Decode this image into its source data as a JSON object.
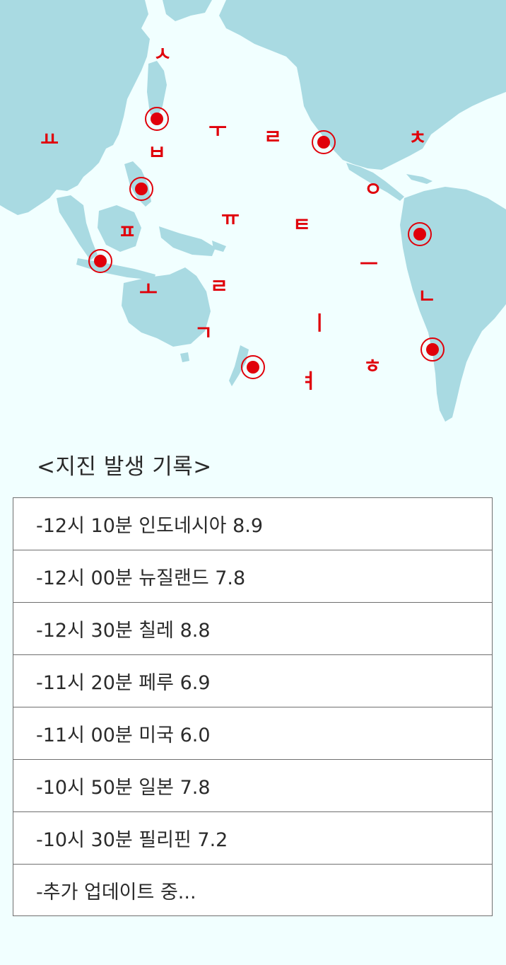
{
  "map": {
    "ocean_color": "#f1ffff",
    "land_color": "#a9dae2",
    "marker_color": "#e0000a",
    "marker_icon": "epicenter-marker-icon",
    "glyphs": [
      "ㅅ",
      "ㅂ",
      "ㅜ",
      "ㄹ",
      "ㅊ",
      "ㅛ",
      "ㅇ",
      "ㅠ",
      "ㅌ",
      "ㅍ",
      "ㅡ",
      "ㄹ",
      "ㅗ",
      "ㄴ",
      "ㄱ",
      "ㅣ",
      "ㅎ",
      "ㅕ"
    ]
  },
  "heading": "<지진 발생 기록>",
  "records": [
    "-12시 10분 인도네시아 8.9",
    "-12시 00분 뉴질랜드 7.8",
    "-12시 30분 칠레 8.8",
    "-11시 20분 페루 6.9",
    "-11시 00분 미국 6.0",
    "-10시 50분 일본 7.8",
    "-10시 30분 필리핀 7.2",
    "-추가 업데이트 중..."
  ]
}
